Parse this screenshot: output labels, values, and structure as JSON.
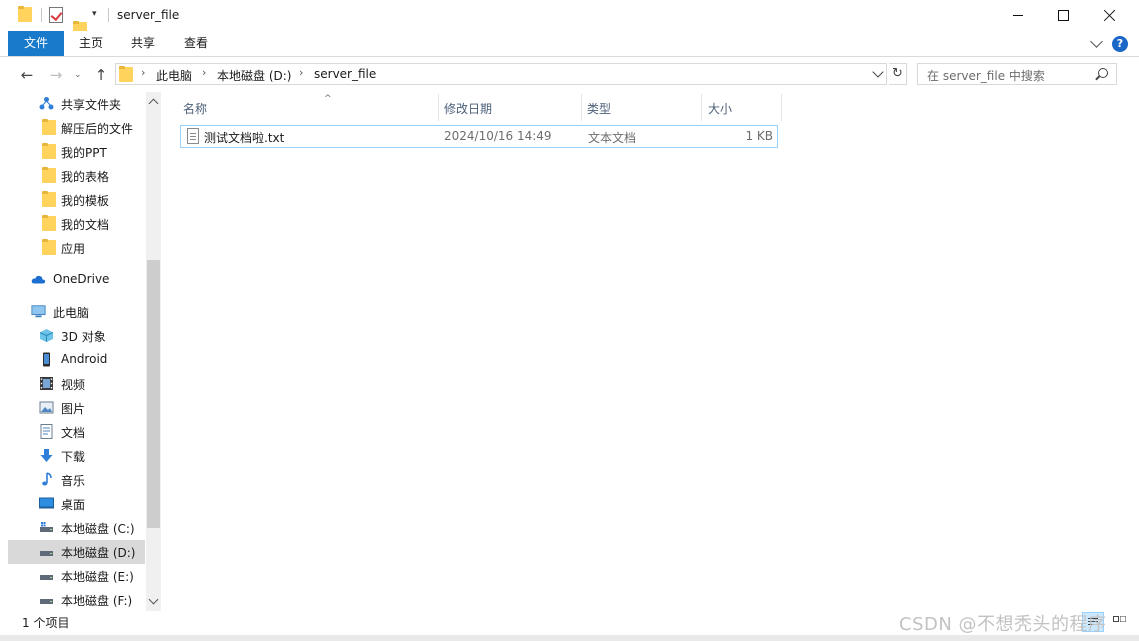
{
  "window": {
    "title": "server_file"
  },
  "ribbon": {
    "tabs": [
      {
        "label": "文件"
      },
      {
        "label": "主页"
      },
      {
        "label": "共享"
      },
      {
        "label": "查看"
      }
    ],
    "help_label": "?"
  },
  "nav": {
    "breadcrumbs": [
      "此电脑",
      "本地磁盘 (D:)",
      "server_file"
    ],
    "search_placeholder": "在 server_file 中搜索"
  },
  "sidebar": {
    "items": [
      {
        "label": "共享文件夹",
        "icon": "share-icon"
      },
      {
        "label": "解压后的文件",
        "icon": "folder-icon"
      },
      {
        "label": "我的PPT",
        "icon": "folder-icon"
      },
      {
        "label": "我的表格",
        "icon": "folder-icon"
      },
      {
        "label": "我的模板",
        "icon": "folder-icon"
      },
      {
        "label": "我的文档",
        "icon": "folder-icon"
      },
      {
        "label": "应用",
        "icon": "folder-icon"
      },
      {
        "label": "OneDrive",
        "icon": "cloud-icon"
      },
      {
        "label": "此电脑",
        "icon": "computer-icon"
      },
      {
        "label": "3D 对象",
        "icon": "cube-icon"
      },
      {
        "label": "Android",
        "icon": "phone-icon"
      },
      {
        "label": "视频",
        "icon": "film-icon"
      },
      {
        "label": "图片",
        "icon": "picture-icon"
      },
      {
        "label": "文档",
        "icon": "document-icon"
      },
      {
        "label": "下载",
        "icon": "download-icon"
      },
      {
        "label": "音乐",
        "icon": "music-icon"
      },
      {
        "label": "桌面",
        "icon": "desktop-icon"
      },
      {
        "label": "本地磁盘 (C:)",
        "icon": "drive-icon"
      },
      {
        "label": "本地磁盘 (D:)",
        "icon": "drive-icon",
        "selected": true
      },
      {
        "label": "本地磁盘 (E:)",
        "icon": "drive-icon"
      },
      {
        "label": "本地磁盘 (F:)",
        "icon": "drive-icon"
      }
    ]
  },
  "files": {
    "columns": [
      "名称",
      "修改日期",
      "类型",
      "大小"
    ],
    "rows": [
      {
        "name": "测试文档啦.txt",
        "modified": "2024/10/16 14:49",
        "type": "文本文档",
        "size": "1 KB"
      }
    ]
  },
  "status": {
    "item_count": "1 个项目"
  },
  "watermark": "CSDN @不想秃头的程序",
  "colors": {
    "accent": "#1979ca",
    "selection": "#cce8ff",
    "folder": "#ffd35c"
  }
}
